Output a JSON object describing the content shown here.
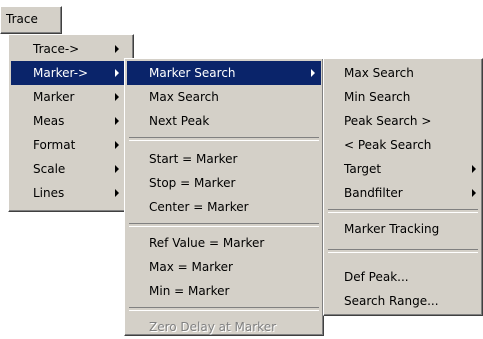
{
  "menubar": {
    "trace_label": "Trace"
  },
  "menu1": {
    "items": [
      {
        "label": "Trace->"
      },
      {
        "label": "Marker->"
      },
      {
        "label": "Marker"
      },
      {
        "label": "Meas"
      },
      {
        "label": "Format"
      },
      {
        "label": "Scale"
      },
      {
        "label": "Lines"
      }
    ]
  },
  "menu2": {
    "items": [
      {
        "label": "Marker Search"
      },
      {
        "label": "Max Search"
      },
      {
        "label": "Next Peak"
      },
      {
        "label": "Start = Marker"
      },
      {
        "label": "Stop = Marker"
      },
      {
        "label": "Center = Marker"
      },
      {
        "label": "Ref Value = Marker"
      },
      {
        "label": "Max = Marker"
      },
      {
        "label": "Min = Marker"
      },
      {
        "label": "Zero Delay at Marker"
      }
    ]
  },
  "menu3": {
    "items": [
      {
        "label": "Max Search"
      },
      {
        "label": "Min Search"
      },
      {
        "label": "Peak Search >"
      },
      {
        "label": "< Peak Search"
      },
      {
        "label": "Target"
      },
      {
        "label": "Bandfilter"
      },
      {
        "label": "Marker Tracking"
      },
      {
        "label": "Def Peak..."
      },
      {
        "label": "Search Range..."
      }
    ]
  },
  "colors": {
    "menu_face": "#d4d0c8",
    "highlight": "#0a246a",
    "disabled_text": "#808080"
  }
}
